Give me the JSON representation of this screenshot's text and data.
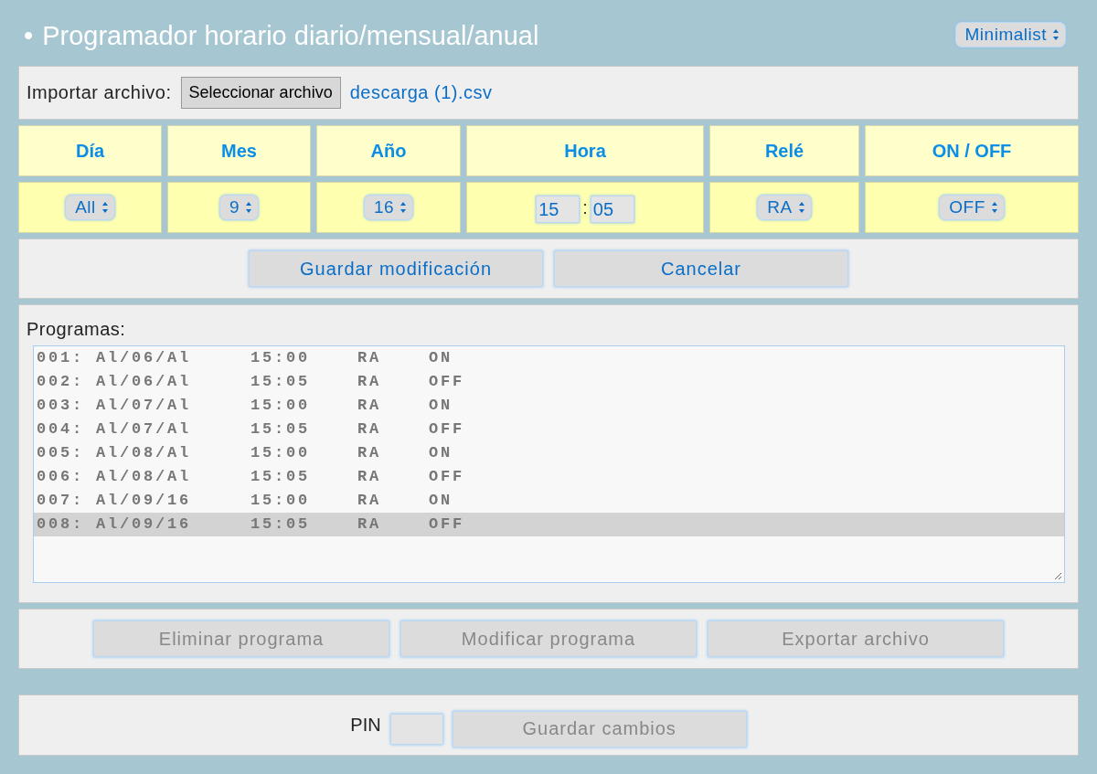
{
  "header": {
    "bullet": "•",
    "title": "Programador horario diario/mensual/anual",
    "theme_select": "Minimalist"
  },
  "import": {
    "label": "Importar archivo:",
    "button": "Seleccionar archivo",
    "file_name": "descarga (1).csv"
  },
  "fields": [
    {
      "label": "Día",
      "kind": "select",
      "value": "All"
    },
    {
      "label": "Mes",
      "kind": "select",
      "value": "9"
    },
    {
      "label": "Año",
      "kind": "select",
      "value": "16"
    },
    {
      "label": "Hora",
      "kind": "time",
      "hours": "15",
      "separator": ":",
      "minutes": "05"
    },
    {
      "label": "Relé",
      "kind": "select",
      "value": "RA"
    },
    {
      "label": "ON / OFF",
      "kind": "select",
      "value": "OFF"
    }
  ],
  "edit_buttons": [
    {
      "label": "Guardar modificación",
      "disabled": false
    },
    {
      "label": "Cancelar",
      "disabled": false
    }
  ],
  "programs": {
    "label": "Programas:",
    "items": [
      {
        "text": "001: Al/06/Al     15:00    RA    ON",
        "selected": false
      },
      {
        "text": "002: Al/06/Al     15:05    RA    OFF",
        "selected": false
      },
      {
        "text": "003: Al/07/Al     15:00    RA    ON",
        "selected": false
      },
      {
        "text": "004: Al/07/Al     15:05    RA    OFF",
        "selected": false
      },
      {
        "text": "005: Al/08/Al     15:00    RA    ON",
        "selected": false
      },
      {
        "text": "006: Al/08/Al     15:05    RA    OFF",
        "selected": false
      },
      {
        "text": "007: Al/09/16     15:00    RA    ON",
        "selected": false
      },
      {
        "text": "008: Al/09/16     15:05    RA    OFF",
        "selected": true
      }
    ]
  },
  "program_buttons": [
    {
      "label": "Eliminar programa",
      "disabled": true
    },
    {
      "label": "Modificar programa",
      "disabled": true
    },
    {
      "label": "Exportar archivo",
      "disabled": true
    }
  ],
  "pin": {
    "label": "PIN",
    "button": {
      "label": "Guardar cambios",
      "disabled": true
    }
  }
}
